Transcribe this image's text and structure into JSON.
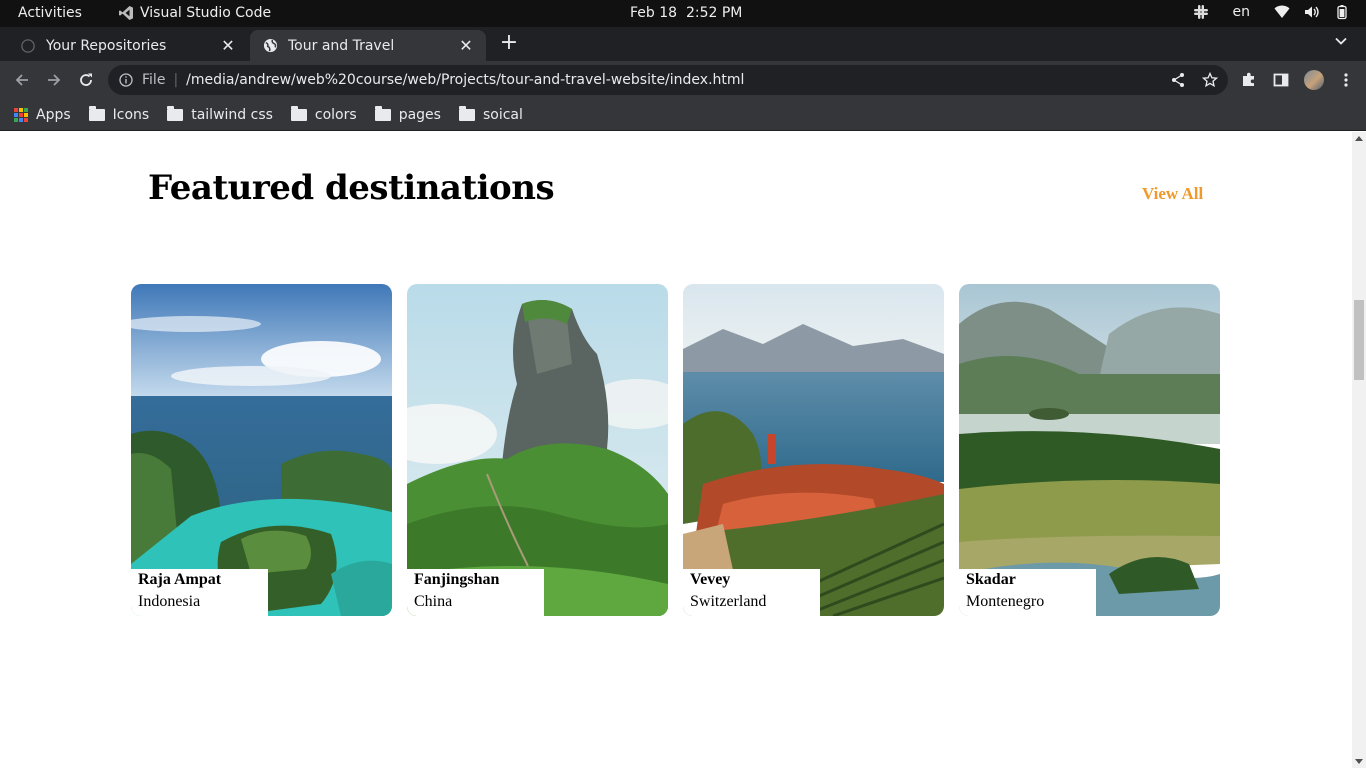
{
  "system_bar": {
    "activities": "Activities",
    "app_name": "Visual Studio Code",
    "clock": "Feb 18  2:52 PM",
    "language": "en",
    "icons": [
      "slack-icon",
      "wifi-icon",
      "volume-icon",
      "battery-icon"
    ]
  },
  "browser": {
    "tabs": [
      {
        "title": "Your Repositories",
        "icon": "github-icon",
        "active": false
      },
      {
        "title": "Tour and Travel",
        "icon": "globe-icon",
        "active": true
      }
    ],
    "address": {
      "scheme": "File",
      "url": "/media/andrew/web%20course/web/Projects/tour-and-travel-website/index.html"
    },
    "bookmarks": [
      "Apps",
      "Icons",
      "tailwind css",
      "colors",
      "pages",
      "soical"
    ]
  },
  "page": {
    "section_title": "Featured destinations",
    "view_all_label": "View All",
    "accent_color": "#f1992a",
    "destinations": [
      {
        "place": "Raja Ampat",
        "country": "Indonesia"
      },
      {
        "place": "Fanjingshan",
        "country": "China"
      },
      {
        "place": "Vevey",
        "country": "Switzerland"
      },
      {
        "place": "Skadar",
        "country": "Montenegro"
      }
    ]
  }
}
